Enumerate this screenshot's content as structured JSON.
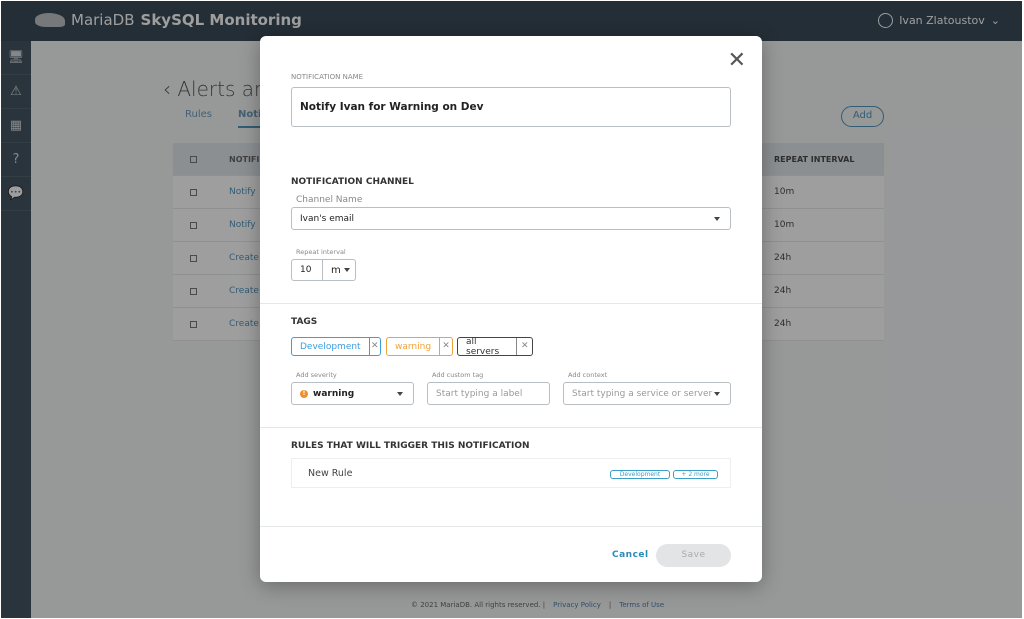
{
  "app": {
    "brand": "MariaDB",
    "title": "SkySQL Monitoring",
    "user": "Ivan Zlatoustov"
  },
  "sidebar": [
    "monitor-icon",
    "alert-icon",
    "grid-icon",
    "help-icon",
    "chat-icon"
  ],
  "page": {
    "title": "Alerts an",
    "tabs": [
      "Rules",
      "Notifi"
    ],
    "add": "Add",
    "table": {
      "headers": [
        "NOTIFI",
        "REPEAT INTERVAL"
      ],
      "rows": [
        {
          "name": "Notify",
          "repeat": "10m"
        },
        {
          "name": "Notify",
          "repeat": "10m"
        },
        {
          "name": "Create",
          "repeat": "24h"
        },
        {
          "name": "Create",
          "repeat": "24h"
        },
        {
          "name": "Create",
          "repeat": "24h"
        }
      ]
    }
  },
  "footer": {
    "copyright": "© 2021 MariaDB. All rights reserved.",
    "privacy": "Privacy Policy",
    "terms": "Terms of Use",
    "sep": "|"
  },
  "modal": {
    "name_label": "NOTIFICATION NAME",
    "name_value": "Notify Ivan for Warning on Dev",
    "channel_heading": "NOTIFICATION CHANNEL",
    "channel_label": "Channel Name",
    "channel_value": "Ivan's email",
    "repeat_label": "Repeat interval",
    "repeat_value": "10",
    "repeat_unit": "m",
    "tags_heading": "TAGS",
    "tags": [
      {
        "label": "Development",
        "color": "#3b9ee0"
      },
      {
        "label": "warning",
        "color": "#f0a13a"
      },
      {
        "label": "all servers",
        "color": "#444444"
      }
    ],
    "severity_label": "Add severity",
    "severity_value": "warning",
    "severity_color": "#f0902a",
    "custom_label": "Add custom tag",
    "custom_placeholder": "Start typing a label",
    "context_label": "Add context",
    "context_placeholder": "Start typing a service or server",
    "rules_heading": "RULES THAT WILL TRIGGER THIS NOTIFICATION",
    "rule": {
      "name": "New Rule",
      "tag": "Development",
      "more": "+ 2 more"
    },
    "cancel": "Cancel",
    "save": "Save"
  }
}
